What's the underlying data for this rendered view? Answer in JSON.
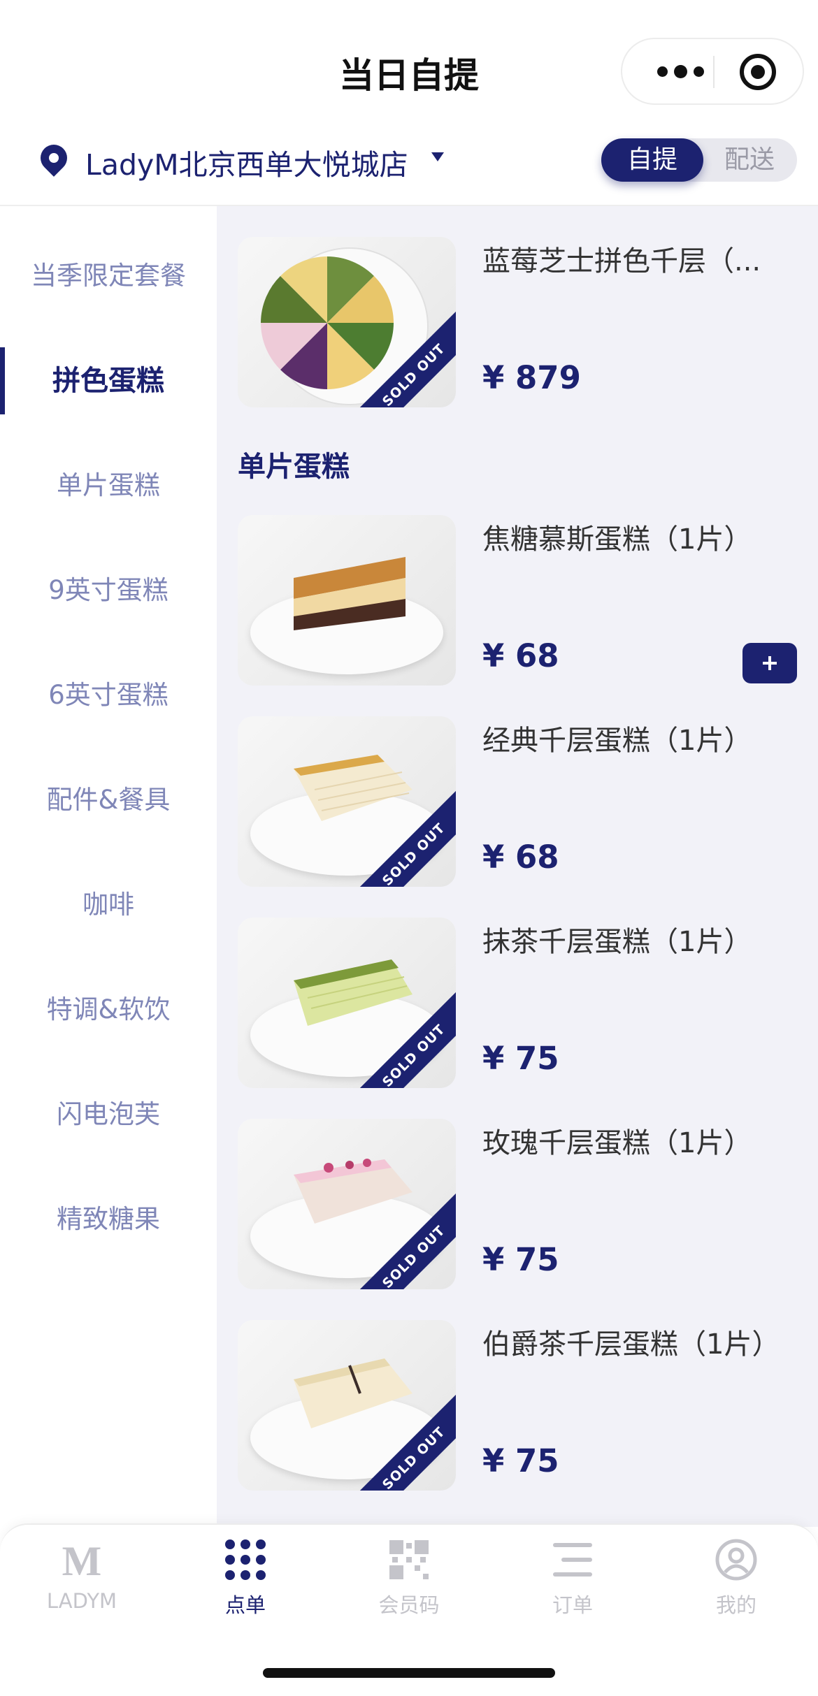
{
  "header": {
    "title": "当日自提",
    "store_name": "LadyM北京西单大悦城店",
    "mode_pickup": "自提",
    "mode_delivery": "配送"
  },
  "sidebar": {
    "items": [
      {
        "label": "当季限定套餐"
      },
      {
        "label": "拼色蛋糕"
      },
      {
        "label": "单片蛋糕"
      },
      {
        "label": "9英寸蛋糕"
      },
      {
        "label": "6英寸蛋糕"
      },
      {
        "label": "配件&餐具"
      },
      {
        "label": "咖啡"
      },
      {
        "label": "特调&软饮"
      },
      {
        "label": "闪电泡芙"
      },
      {
        "label": "精致糖果"
      }
    ],
    "active_index": 1
  },
  "content": {
    "section_single_slice": "单片蛋糕",
    "sold_out_label": "SOLD OUT",
    "products": [
      {
        "name": "蓝莓芝士拼色千层（...",
        "price": "¥ 879",
        "sold_out": true
      },
      {
        "name": "焦糖慕斯蛋糕（1片）",
        "price": "¥ 68",
        "sold_out": false
      },
      {
        "name": "经典千层蛋糕（1片）",
        "price": "¥ 68",
        "sold_out": true
      },
      {
        "name": "抹茶千层蛋糕（1片）",
        "price": "¥ 75",
        "sold_out": true
      },
      {
        "name": "玫瑰千层蛋糕（1片）",
        "price": "¥ 75",
        "sold_out": true
      },
      {
        "name": "伯爵茶千层蛋糕（1片）",
        "price": "¥ 75",
        "sold_out": true
      }
    ]
  },
  "tabbar": {
    "items": [
      {
        "label": "LADYM",
        "icon": "ladym-logo-icon"
      },
      {
        "label": "点单",
        "icon": "grid-dots-icon"
      },
      {
        "label": "会员码",
        "icon": "qr-code-icon"
      },
      {
        "label": "订单",
        "icon": "list-icon"
      },
      {
        "label": "我的",
        "icon": "user-icon"
      }
    ],
    "active_index": 1
  },
  "colors": {
    "brand_navy": "#1c2270",
    "sidebar_inactive": "#7f86b7",
    "content_bg": "#f2f2f8"
  }
}
